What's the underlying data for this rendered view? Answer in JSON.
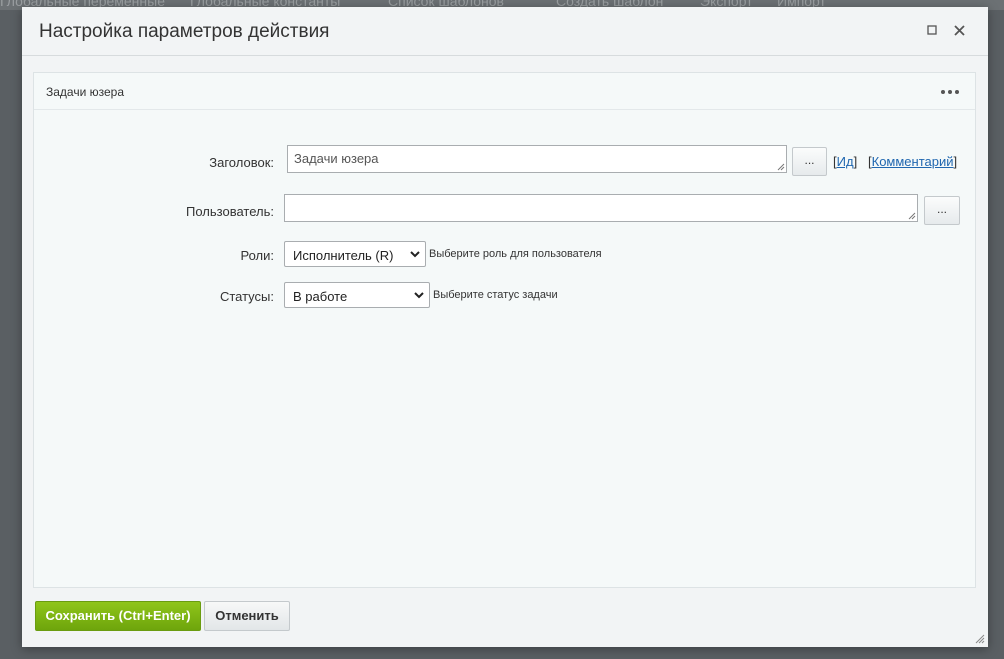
{
  "background_nav": [
    "Глобальные переменные",
    "Глобальные константы",
    "Список шаблонов",
    "Создать шаблон",
    "Экспорт",
    "Импорт"
  ],
  "dialog": {
    "title": "Настройка параметров действия",
    "icons": {
      "maximize": "maximize-icon",
      "close": "close-icon"
    }
  },
  "panel": {
    "title": "Задачи юзера",
    "menu_icon": "more-dots-icon"
  },
  "form": {
    "title_label": "Заголовок:",
    "title_value": "Задачи юзера",
    "title_picker": "...",
    "id_link": "Ид",
    "comment_link": "Комментарий",
    "user_label": "Пользователь:",
    "user_value": "",
    "user_picker": "...",
    "roles_label": "Роли:",
    "roles_selected": "Исполнитель (R)",
    "roles_hint": "Выберите роль для пользователя",
    "status_label": "Статусы:",
    "status_selected": "В работе",
    "status_hint": "Выберите статус задачи"
  },
  "footer": {
    "save_label": "Сохранить (Ctrl+Enter)",
    "cancel_label": "Отменить"
  },
  "colors": {
    "accent_green": "#7ab317",
    "link_blue": "#2067b0",
    "overlay": "#5a5f63"
  }
}
